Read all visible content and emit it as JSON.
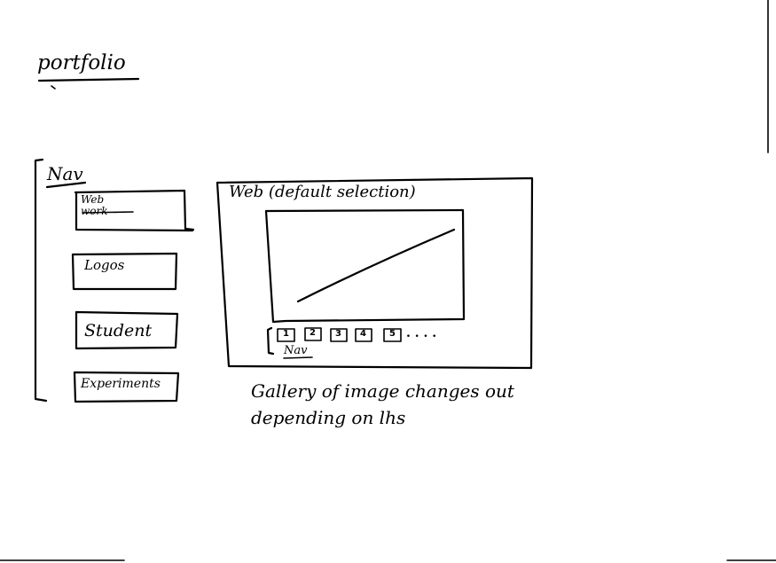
{
  "page": {
    "title": "portfolio"
  },
  "nav": {
    "label": "Nav",
    "items": [
      {
        "label": "Web work"
      },
      {
        "label": "Logos"
      },
      {
        "label": "Student"
      },
      {
        "label": "Experiments"
      }
    ]
  },
  "gallery": {
    "title": "Web (default selection)",
    "thumbnail_labels": [
      "1",
      "2",
      "3",
      "4",
      "5"
    ],
    "ellipsis": ". . . .",
    "sub_nav_label": "Nav",
    "note": "Gallery of image changes out depending on lhs"
  }
}
